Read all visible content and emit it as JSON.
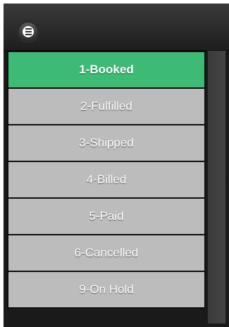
{
  "header": {
    "menu_icon": "hamburger-menu-icon"
  },
  "colors": {
    "active_item": "#3dbb75",
    "inactive_item": "#bcbcbc",
    "header_dark": "#1e1e1e"
  },
  "menu": {
    "items": [
      {
        "label": "1-Booked",
        "active": true
      },
      {
        "label": "2-Fulfilled",
        "active": false
      },
      {
        "label": "3-Shipped",
        "active": false
      },
      {
        "label": "4-Billed",
        "active": false
      },
      {
        "label": "5-Paid",
        "active": false
      },
      {
        "label": "6-Cancelled",
        "active": false
      },
      {
        "label": "9-On Hold",
        "active": false
      }
    ]
  }
}
